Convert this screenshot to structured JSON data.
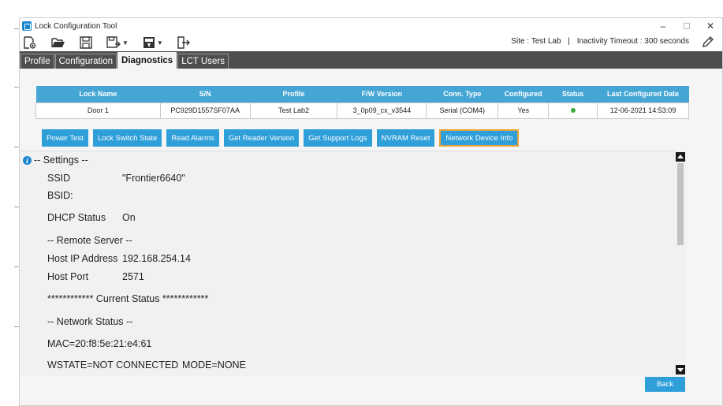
{
  "window": {
    "title": "Lock Configuration Tool"
  },
  "toolbar": {
    "site_label": "Site :",
    "site_value": "Test Lab",
    "timeout_label": "Inactivity Timeout :",
    "timeout_value": "300 seconds"
  },
  "tabs": [
    {
      "label": "Profile"
    },
    {
      "label": "Configuration"
    },
    {
      "label": "Diagnostics",
      "active": true
    },
    {
      "label": "LCT Users"
    }
  ],
  "table": {
    "headers": [
      "Lock Name",
      "S/N",
      "Profile",
      "F/W Version",
      "Conn. Type",
      "Configured",
      "Status",
      "Last Configured Date"
    ],
    "row": {
      "lock_name": "Door 1",
      "sn": "PC929D1557SF07AA",
      "profile": "Test Lab2",
      "fw_version": "3_0p09_cx_v3544",
      "conn_type": "Serial (COM4)",
      "configured": "Yes",
      "status_color": "#3aaa35",
      "last_configured": "12-06-2021 14:53:09"
    }
  },
  "actions": [
    {
      "label": "Power Test"
    },
    {
      "label": "Lock Switch State"
    },
    {
      "label": "Read Alarms"
    },
    {
      "label": "Get Reader Version"
    },
    {
      "label": "Get Support Logs"
    },
    {
      "label": "NVRAM Reset"
    },
    {
      "label": "Network Device Info",
      "selected": true
    }
  ],
  "output": {
    "settings_header": "-- Settings --",
    "ssid_label": "SSID",
    "ssid_value": "\"Frontier6640\"",
    "bsid_label": "BSID:",
    "dhcp_label": "DHCP Status",
    "dhcp_value": "On",
    "remote_header": "-- Remote Server --",
    "host_ip_label": "Host IP Address",
    "host_ip_value": "192.168.254.14",
    "host_port_label": "Host Port",
    "host_port_value": "2571",
    "current_status": "************ Current Status ************",
    "network_header": "-- Network Status --",
    "mac": "MAC=20:f8:5e:21:e4:61",
    "wstate": "WSTATE=NOT CONNECTED",
    "mode": "MODE=NONE"
  },
  "back_label": "Back",
  "colors": {
    "accent": "#2f9fd9",
    "header": "#45a6d6",
    "tabbar": "#4e4e4e",
    "selected_border": "#e8a33a"
  }
}
